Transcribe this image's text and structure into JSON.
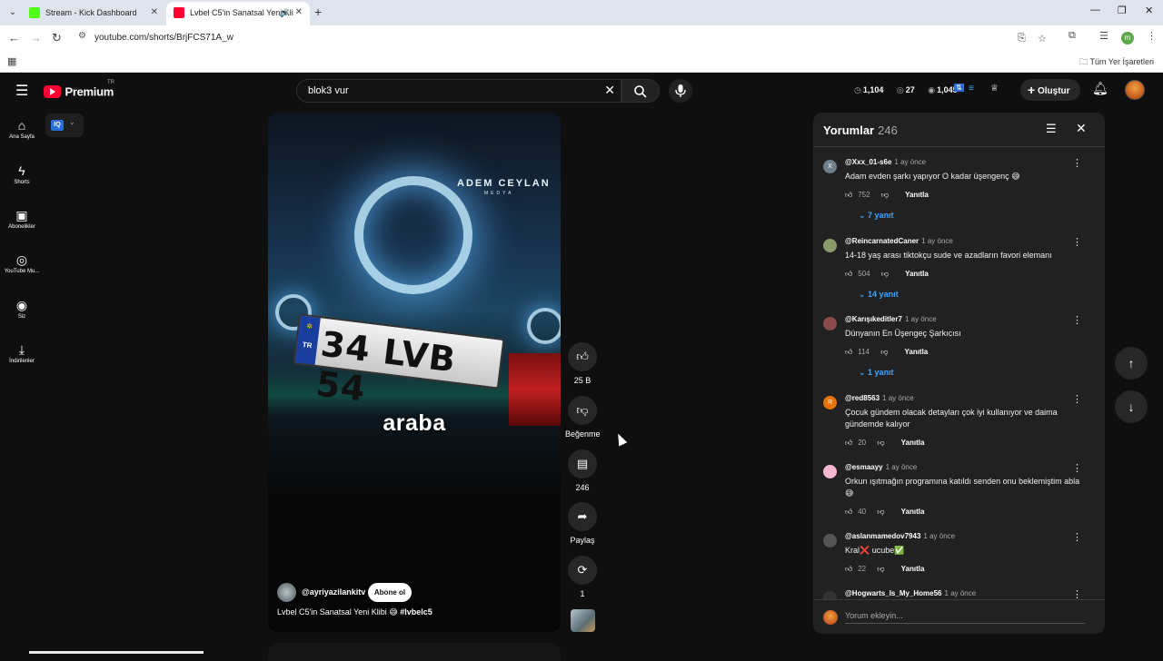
{
  "browser": {
    "tabs": [
      {
        "title": "Stream - Kick Dashboard",
        "favicon_color": "#53fc18",
        "active": false
      },
      {
        "title": "Lvbel C5'in Sanatsal Yeni Kli",
        "favicon_color": "#ff0033",
        "active": true
      }
    ],
    "url": "youtube.com/shorts/BrjFCS71A_w",
    "bookmarks_label": "Tüm Yer İşaretleri",
    "profile_initial": "m"
  },
  "header": {
    "logo_text": "Premium",
    "region": "TR",
    "search_value": "blok3 vur",
    "stats": [
      {
        "icon": "clock-icon",
        "value": "1,104"
      },
      {
        "icon": "eye-icon",
        "value": "27"
      },
      {
        "icon": "eye-icon",
        "value": "1,045"
      }
    ],
    "create_label": "Oluştur"
  },
  "guide": [
    {
      "icon": "home-icon",
      "label": "Ana Sayfa"
    },
    {
      "icon": "shorts-icon",
      "label": "Shorts"
    },
    {
      "icon": "subscriptions-icon",
      "label": "Abonelikler"
    },
    {
      "icon": "youtube-music-icon",
      "label": "YouTube Mu..."
    },
    {
      "icon": "you-icon",
      "label": "Siz"
    },
    {
      "icon": "downloads-icon",
      "label": "İndirilenler"
    }
  ],
  "iq_label": "IQ",
  "video": {
    "plate_country": "TR",
    "plate_text": "34 LVB 54",
    "watermark": "ADEM CEYLAN",
    "watermark_sub": "MEDYA",
    "caption": "araba",
    "channel": "@ayriyazilankitv",
    "subscribe_label": "Abone ol",
    "title": "Lvbel C5'in Sanatsal Yeni Klibi 😅",
    "hashtag": "#lvbelc5"
  },
  "actions": {
    "like_count": "25 B",
    "dislike_label": "Beğenme",
    "comment_count": "246",
    "share_label": "Paylaş",
    "remix_count": "1"
  },
  "comments": {
    "title": "Yorumlar",
    "count": "246",
    "input_placeholder": "Yorum ekleyin...",
    "reply_label": "Yanıtla",
    "items": [
      {
        "author": "@Xxx_01-s6e",
        "time": "1 ay önce",
        "text": "Adam evden şarkı yapıyor O kadar üşengenç 😅",
        "likes": "752",
        "replies": "7 yanıt",
        "avatar": "X",
        "avatar_color": "#6f7f8c"
      },
      {
        "author": "@ReincarnatedCaner",
        "time": "1 ay önce",
        "text": "14-18 yaş arası tiktokçu sude ve azadların favori elemanı",
        "likes": "504",
        "replies": "14 yanıt",
        "avatar": "",
        "avatar_color": "#8a9a6a"
      },
      {
        "author": "@Karışıkeditler7",
        "time": "1 ay önce",
        "text": "Dünyanın En Üşengeç Şarkıcısı",
        "likes": "114",
        "replies": "1 yanıt",
        "avatar": "",
        "avatar_color": "#8a4a4a"
      },
      {
        "author": "@red8563",
        "time": "1 ay önce",
        "text": "Çocuk gündem olacak detayları çok iyi kullanıyor ve daima gündemde kalıyor",
        "likes": "20",
        "replies": "",
        "avatar": "R",
        "avatar_color": "#e8710a"
      },
      {
        "author": "@esmaayy",
        "time": "1 ay önce",
        "text": "Orkun ışıtmağın programına katıldı senden onu beklemiştim abla 😅",
        "likes": "40",
        "replies": "",
        "avatar": "",
        "avatar_color": "#f7b6d2"
      },
      {
        "author": "@aslanmamedov7943",
        "time": "1 ay önce",
        "text": "Kral❌ ucube✅",
        "likes": "22",
        "replies": "",
        "avatar": "",
        "avatar_color": "#555555"
      },
      {
        "author": "@Hogwarts_Is_My_Home56",
        "time": "1 ay önce",
        "text": "",
        "likes": "",
        "replies": "",
        "avatar": "",
        "avatar_color": "#333333"
      }
    ]
  }
}
